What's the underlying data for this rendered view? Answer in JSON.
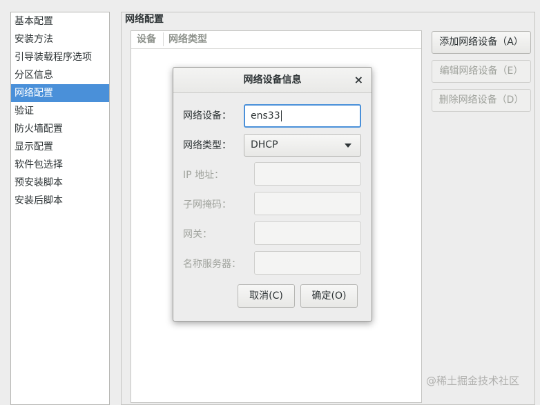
{
  "sidebar": {
    "items": [
      {
        "label": "基本配置"
      },
      {
        "label": "安装方法"
      },
      {
        "label": "引导装载程序选项"
      },
      {
        "label": "分区信息"
      },
      {
        "label": "网络配置",
        "selected": true
      },
      {
        "label": "验证"
      },
      {
        "label": "防火墙配置"
      },
      {
        "label": "显示配置"
      },
      {
        "label": "软件包选择"
      },
      {
        "label": "预安装脚本"
      },
      {
        "label": "安装后脚本"
      }
    ]
  },
  "network": {
    "section_title": "网络配置",
    "table_columns": [
      "设备",
      "网络类型"
    ],
    "buttons": {
      "add": "添加网络设备（A）",
      "edit": "编辑网络设备（E）",
      "delete": "删除网络设备（D）"
    }
  },
  "dialog": {
    "title": "网络设备信息",
    "close_glyph": "×",
    "device_label": "网络设备：",
    "device_value": "ens33",
    "type_label": "网络类型：",
    "type_value": "DHCP",
    "ip_label": "IP 地址：",
    "netmask_label": "子网掩码：",
    "gateway_label": "网关：",
    "dns_label": "名称服务器：",
    "cancel": "取消(C)",
    "ok": "确定(O)"
  },
  "watermark": "@稀土掘金技术社区",
  "colors": {
    "selection": "#4a90d9",
    "background": "#ededed"
  }
}
